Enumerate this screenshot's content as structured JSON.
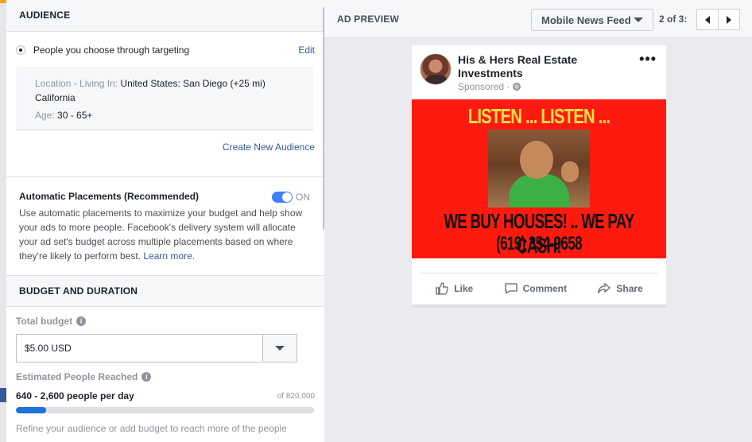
{
  "audience": {
    "header": "AUDIENCE",
    "targeting_label": "People you choose through targeting",
    "edit_label": "Edit",
    "location_key": "Location - Living In:",
    "location_value": "United States: San Diego (+25 mi)",
    "location_value_2": "California",
    "age_key": "Age:",
    "age_value": "30 - 65+",
    "create_new": "Create New Audience"
  },
  "placements": {
    "title": "Automatic Placements (Recommended)",
    "toggle_state": "ON",
    "description": "Use automatic placements to maximize your budget and help show your ads to more people. Facebook's delivery system will allocate your ad set's budget across multiple placements based on where they're likely to perform best.",
    "learn_more": "Learn more."
  },
  "budget": {
    "header": "BUDGET AND DURATION",
    "total_label": "Total budget",
    "total_value": "$5.00 USD",
    "reach_label": "Estimated People Reached",
    "reach_value": "640 - 2,600 people per day",
    "reach_total": "of 820,000",
    "reach_fraction": 0.1,
    "refine_text": "Refine your audience or add budget to reach more of the people"
  },
  "preview": {
    "header": "AD PREVIEW",
    "placement": "Mobile News Feed",
    "page_count": "2 of 3:"
  },
  "ad": {
    "page_name": "His & Hers Real Estate Investments",
    "sponsored": "Sponsored ·",
    "headline": "LISTEN ... LISTEN ... LISTEN",
    "tagline": "WE BUY HOUSES! .. WE PAY CASH!",
    "phone": "(619) 354-9658",
    "like": "Like",
    "comment": "Comment",
    "share": "Share"
  },
  "colors": {
    "link": "#365899",
    "toggle_on": "#4080ff",
    "ad_background": "#ff1a0f",
    "ad_headline": "#ffe14a"
  }
}
